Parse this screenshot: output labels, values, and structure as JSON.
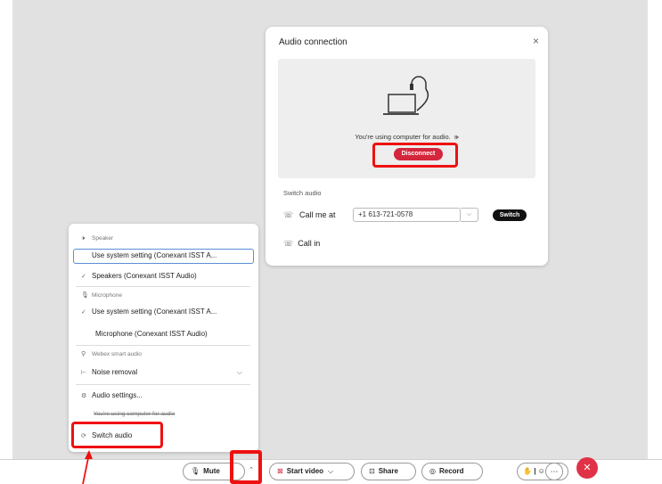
{
  "dialog": {
    "title": "Audio connection",
    "close_glyph": "×",
    "using_text": "You're using computer for audio.",
    "disconnect_label": "Disconnect",
    "switch_audio_label": "Switch audio",
    "call_me_label": "Call me at",
    "phone_value": "+1 613-721-0578",
    "switch_button_label": "Switch",
    "call_in_label": "Call in"
  },
  "menu": {
    "speaker_section": "Speaker",
    "speaker_options": [
      "Use system setting (Conexant ISST A...",
      "Speakers (Conexant ISST Audio)"
    ],
    "microphone_section": "Microphone",
    "microphone_options": [
      "Use system setting (Conexant ISST A...",
      "Microphone (Conexant ISST Audio)"
    ],
    "smart_audio_section": "Webex smart audio",
    "noise_removal_label": "Noise removal",
    "audio_settings_label": "Audio settings...",
    "using_computer_note": "You're using computer for audio",
    "switch_audio_label": "Switch audio"
  },
  "toolbar": {
    "mute_label": "Mute",
    "start_video_label": "Start video",
    "share_label": "Share",
    "record_label": "Record"
  },
  "icons": [
    "headset-icon",
    "speaker-icon",
    "microphone-icon",
    "phone-icon",
    "video-icon",
    "share-icon",
    "record-icon",
    "reactions-icon",
    "more-icon",
    "end-call-icon"
  ],
  "colors": {
    "danger": "#d4263c",
    "highlight": "#ee1111",
    "selected_border": "#5a8fd6"
  }
}
